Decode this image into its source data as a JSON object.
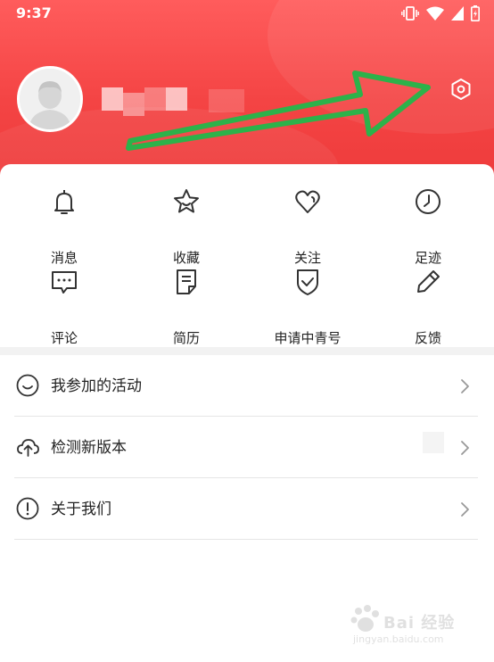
{
  "status_bar": {
    "time": "9:37"
  },
  "profile": {
    "avatar_icon": "default-avatar-icon",
    "settings_icon": "settings-hexagon-icon",
    "annotation_arrow_color": "#2db24a"
  },
  "quick_actions": [
    {
      "label": "消息",
      "icon": "bell-icon"
    },
    {
      "label": "收藏",
      "icon": "star-icon"
    },
    {
      "label": "关注",
      "icon": "heart-icon"
    },
    {
      "label": "足迹",
      "icon": "clock-icon"
    },
    {
      "label": "评论",
      "icon": "comment-icon"
    },
    {
      "label": "简历",
      "icon": "document-icon"
    },
    {
      "label": "申请中青号",
      "icon": "shield-check-icon"
    },
    {
      "label": "反馈",
      "icon": "pencil-icon"
    }
  ],
  "menu": [
    {
      "label": "我参加的活动",
      "icon": "smile-icon"
    },
    {
      "label": "检测新版本",
      "icon": "cloud-upload-icon"
    },
    {
      "label": "关于我们",
      "icon": "exclamation-circle-icon"
    }
  ],
  "watermark": {
    "text": "Bai 经验",
    "sub": "jingyan.baidu.com"
  },
  "colors": {
    "header": "#f44444",
    "text": "#222222",
    "icon_stroke": "#333333"
  }
}
